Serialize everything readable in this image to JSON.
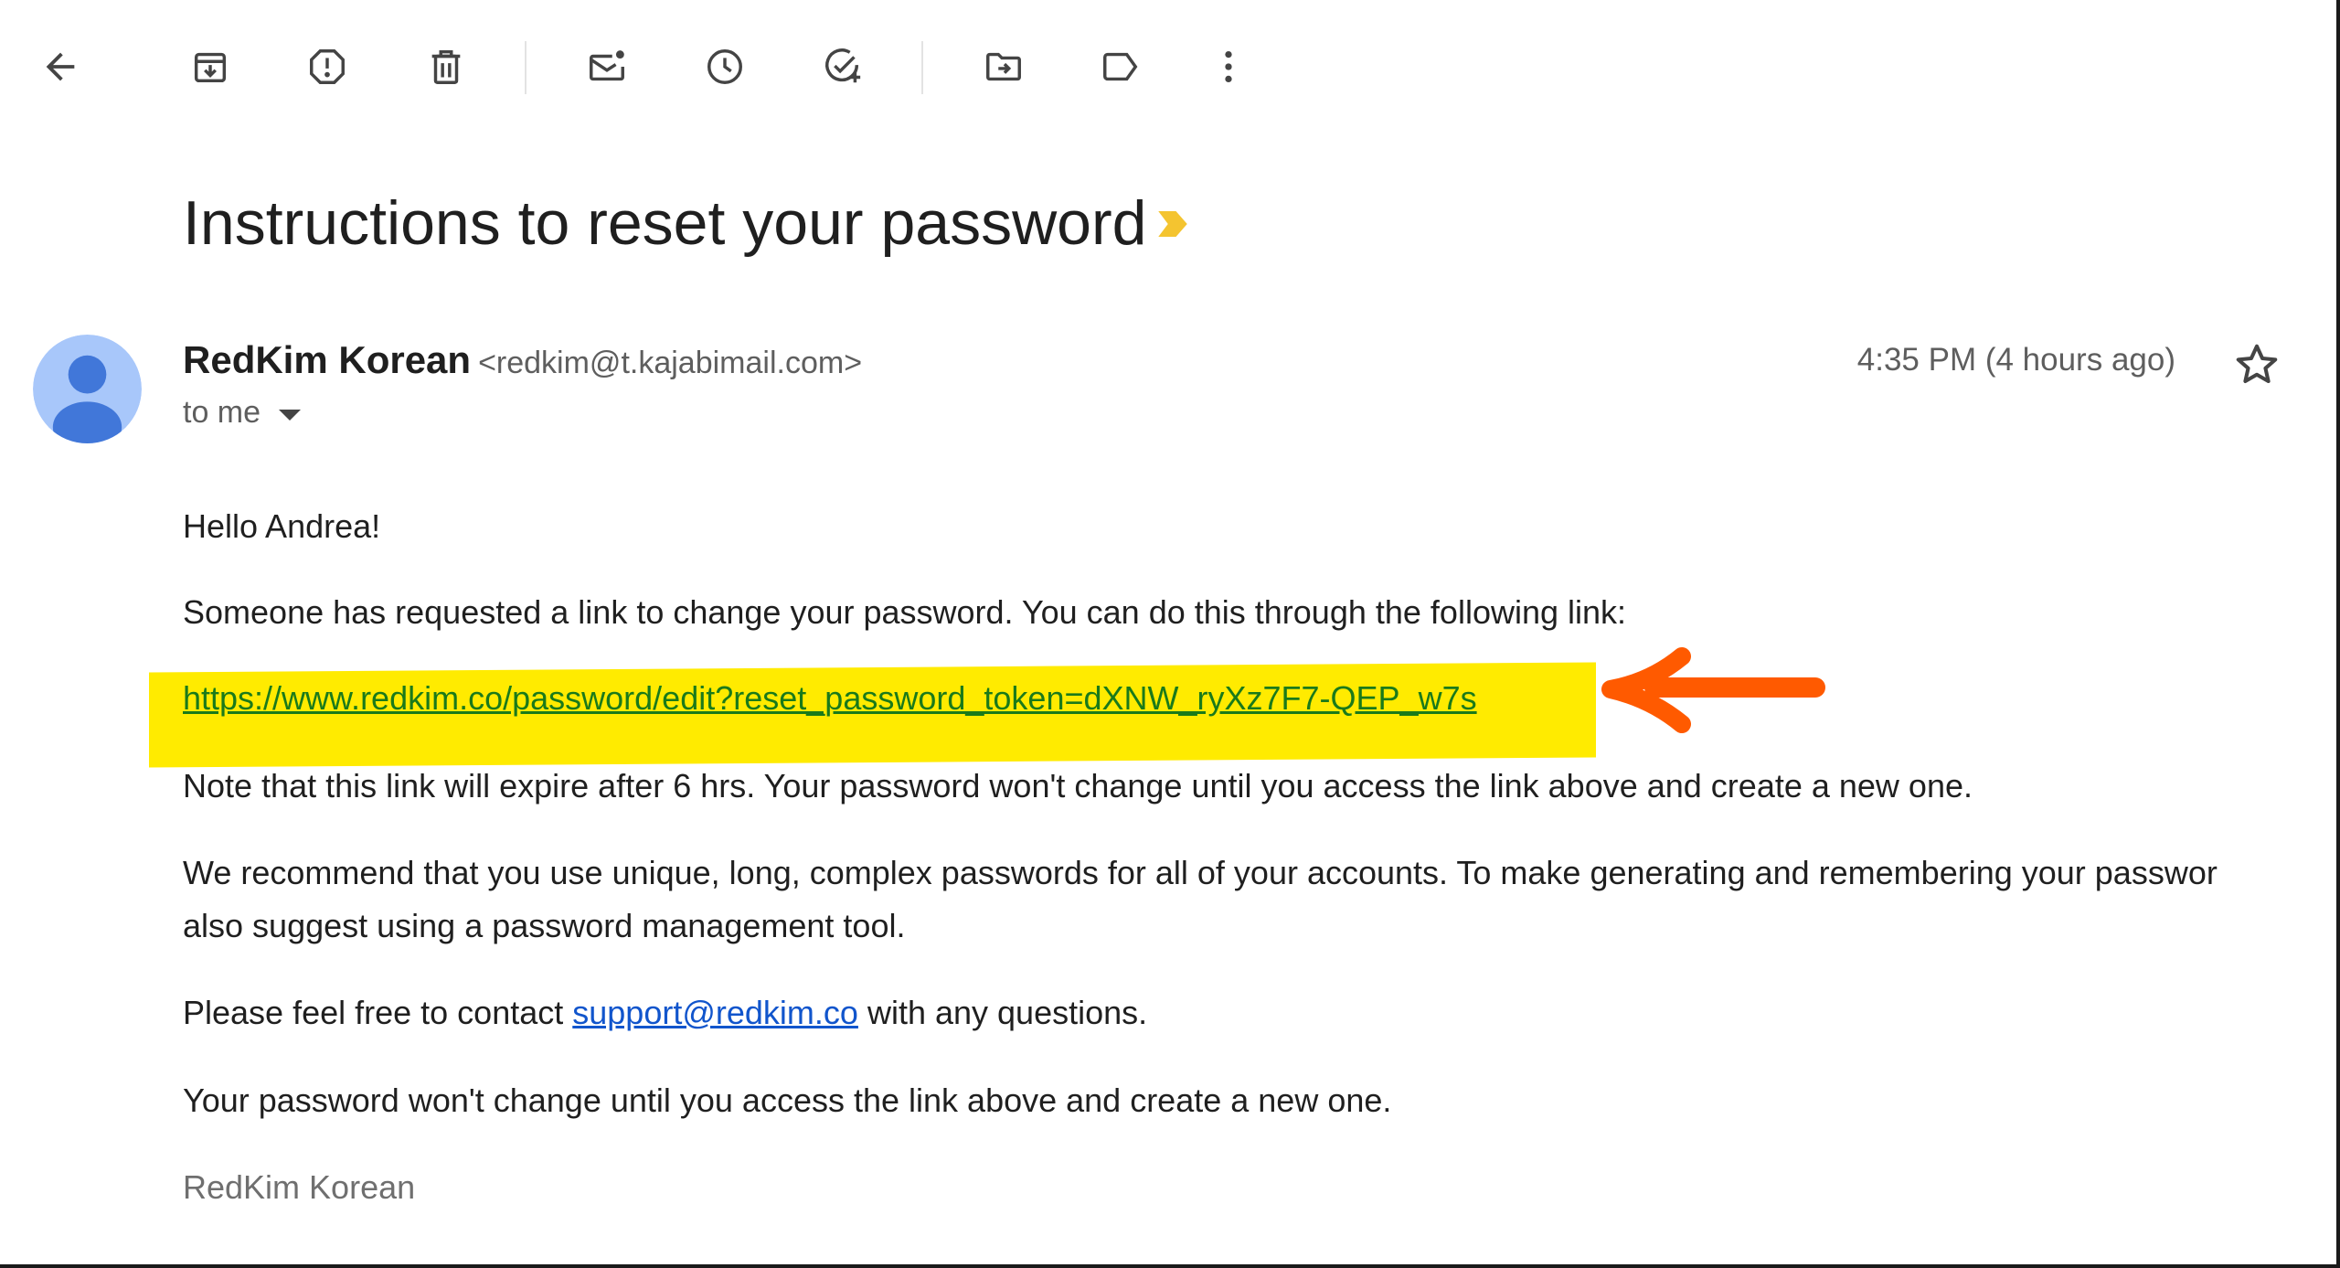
{
  "toolbar": {
    "buttons": [
      {
        "icon": "back-arrow-icon"
      },
      {
        "icon": "archive-icon"
      },
      {
        "icon": "report-spam-icon"
      },
      {
        "icon": "delete-icon"
      },
      {
        "icon": "mark-unread-icon"
      },
      {
        "icon": "snooze-icon"
      },
      {
        "icon": "add-task-icon"
      },
      {
        "icon": "move-to-icon"
      },
      {
        "icon": "label-icon"
      },
      {
        "icon": "more-options-icon"
      }
    ]
  },
  "email": {
    "subject": "Instructions to reset your password",
    "sender_name": "RedKim Korean",
    "sender_email": "<redkim@t.kajabimail.com>",
    "recipient": "to me",
    "timestamp": "4:35 PM (4 hours ago)",
    "greeting": "Hello Andrea!",
    "paragraph_request": "Someone has requested a link to change your password. You can do this through the following link:",
    "reset_link": "https://www.redkim.co/password/edit?reset_password_token=dXNW_ryXz7F7-QEP_w7s",
    "paragraph_expire": "Note that this link will expire after 6 hrs. Your password won't change until you access the link above and create a new one.",
    "paragraph_recommend_line1": "We recommend that you use unique, long, complex passwords for all of your accounts. To make generating and remembering your passwor",
    "paragraph_recommend_line2": "also suggest using a password management tool.",
    "contact_prefix": "Please feel free to contact",
    "contact_email": "support@redkim.co",
    "contact_suffix": "with any questions.",
    "paragraph_final": "Your password won't change until you access the link above and create a new one.",
    "signature": "RedKim Korean"
  },
  "colors": {
    "highlight": "#ffeb00",
    "annotation_arrow": "#ff5a00",
    "link_green": "#1a7a1a",
    "link_blue": "#1155cc",
    "important_marker": "#f4c430",
    "avatar_bg": "#a8c7fa",
    "avatar_fg": "#4177d9"
  }
}
